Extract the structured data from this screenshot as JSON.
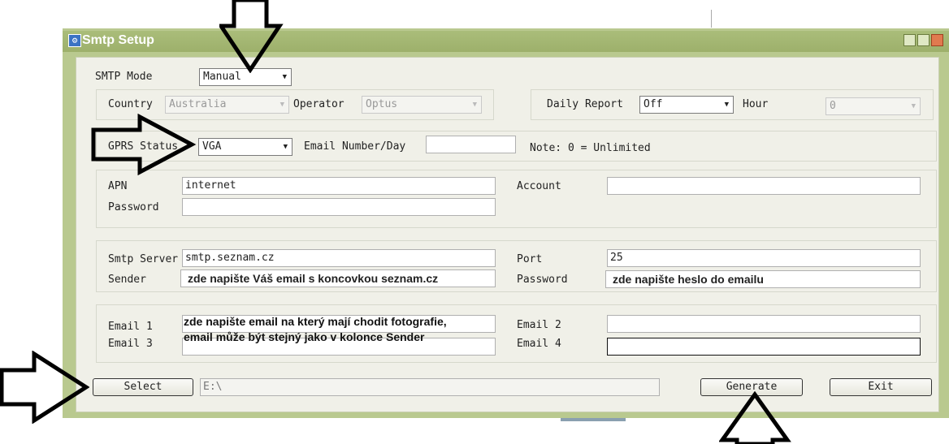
{
  "window": {
    "title": "Smtp Setup"
  },
  "smtp_mode": {
    "label": "SMTP Mode",
    "value": "Manual"
  },
  "country": {
    "label": "Country",
    "value": "Australia"
  },
  "operator": {
    "label": "Operator",
    "value": "Optus"
  },
  "daily_report": {
    "label": "Daily Report",
    "value": "Off"
  },
  "hour": {
    "label": "Hour",
    "value": "0"
  },
  "gprs_status": {
    "label": "GPRS Status",
    "value": "VGA"
  },
  "email_number": {
    "label": "Email Number/Day",
    "value": ""
  },
  "note": "Note: 0 = Unlimited",
  "apn": {
    "label": "APN",
    "value": "internet"
  },
  "account": {
    "label": "Account",
    "value": ""
  },
  "gprs_password": {
    "label": "Password",
    "value": ""
  },
  "smtp_server": {
    "label": "Smtp Server",
    "value": "smtp.seznam.cz"
  },
  "port": {
    "label": "Port",
    "value": "25"
  },
  "sender": {
    "label": "Sender",
    "value": "zde napište Váš email s koncovkou seznam.cz"
  },
  "smtp_password": {
    "label": "Password",
    "value": "zde napište heslo do emailu"
  },
  "email1": {
    "label": "Email 1",
    "value": ""
  },
  "email2": {
    "label": "Email 2",
    "value": ""
  },
  "email3": {
    "label": "Email 3",
    "value": ""
  },
  "email4": {
    "label": "Email 4",
    "value": ""
  },
  "email_note": {
    "line1": "zde napište email na který mají chodit fotografie,",
    "line2": "email může být stejný jako v kolonce Sender"
  },
  "select_button": "Select",
  "path": "E:\\",
  "generate_button": "Generate",
  "exit_button": "Exit",
  "colors": {
    "titlebar": "#9db06b",
    "frame": "#b9c98f",
    "client": "#f0f0e8"
  },
  "icons": [
    "gear-icon",
    "minimize-icon",
    "maximize-icon",
    "close-icon",
    "dropdown-arrow-icon",
    "arrow-annotation"
  ]
}
